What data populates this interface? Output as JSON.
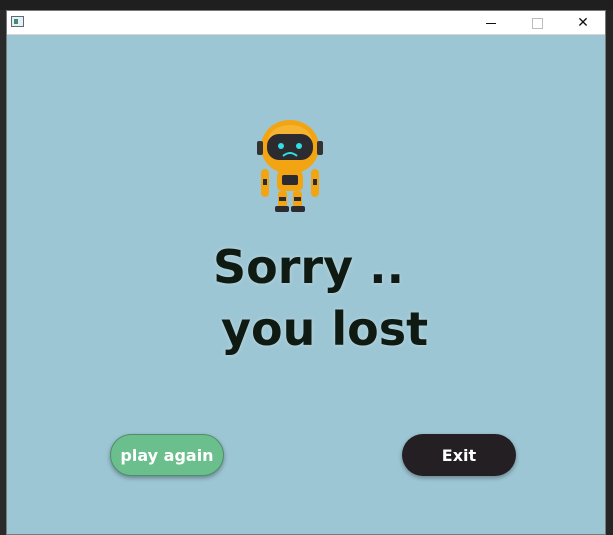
{
  "window": {
    "app_icon": "window-app-icon",
    "controls": {
      "minimize_icon": "minimize-icon",
      "maximize_icon": "maximize-icon",
      "close_icon": "close-icon",
      "close_glyph": "✕"
    }
  },
  "content": {
    "image": "sad-robot",
    "message_line1": "Sorry ..",
    "message_line2": "you lost"
  },
  "buttons": {
    "play_again": "play again",
    "exit": "Exit"
  },
  "colors": {
    "background": "#9dc6d4",
    "play_button": "#6bbf8c",
    "exit_button": "#231f22",
    "text": "#0e1a12"
  }
}
